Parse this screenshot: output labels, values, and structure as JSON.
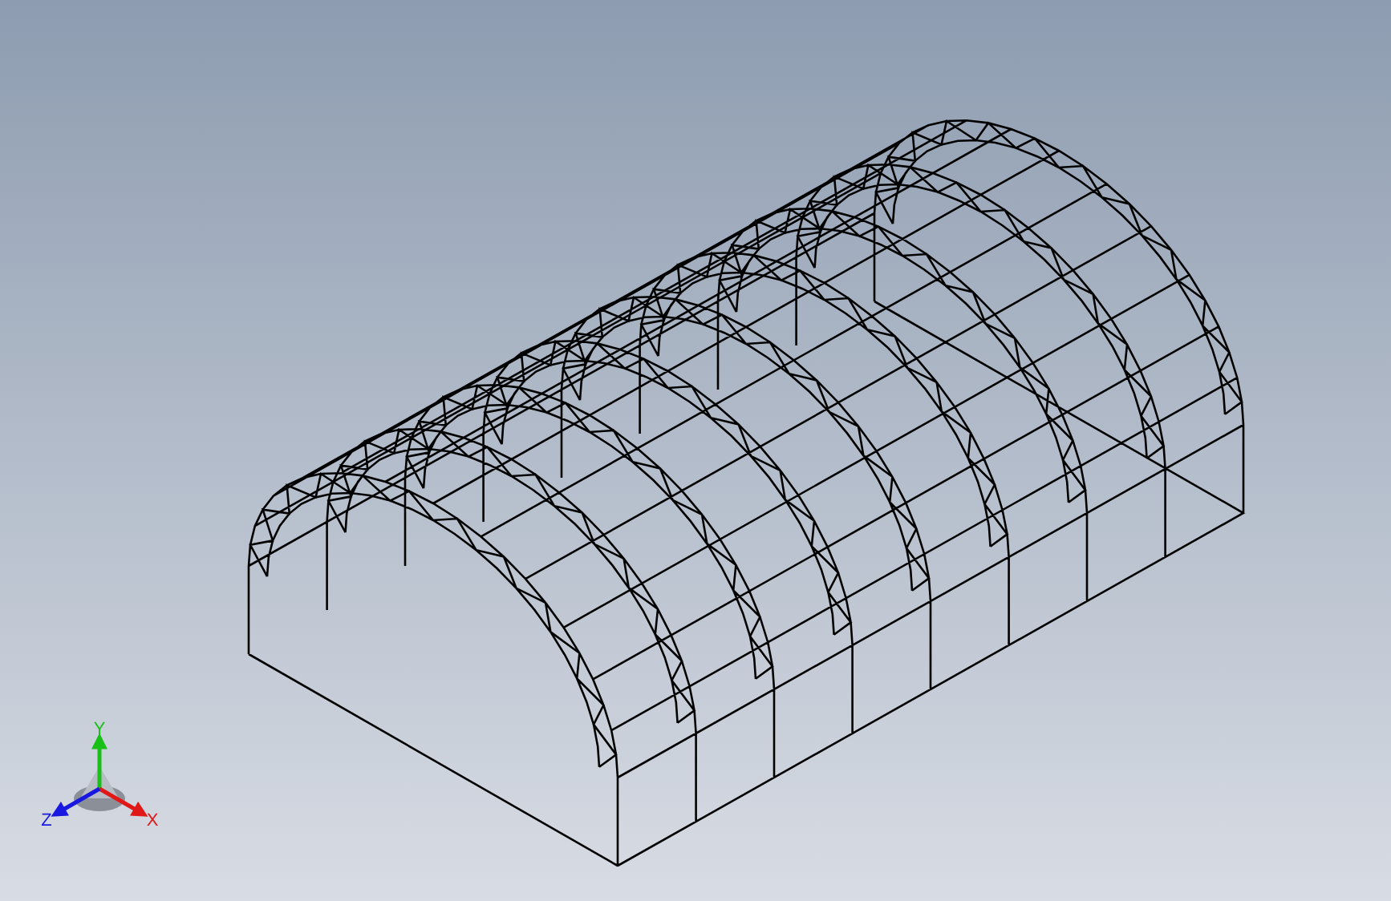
{
  "viewport": {
    "triad": {
      "axes": [
        {
          "kind": "y",
          "label": "Y",
          "color": "#18c018"
        },
        {
          "kind": "x",
          "label": "X",
          "color": "#e01818"
        },
        {
          "kind": "z",
          "label": "Z",
          "color": "#1818e0"
        }
      ]
    }
  }
}
